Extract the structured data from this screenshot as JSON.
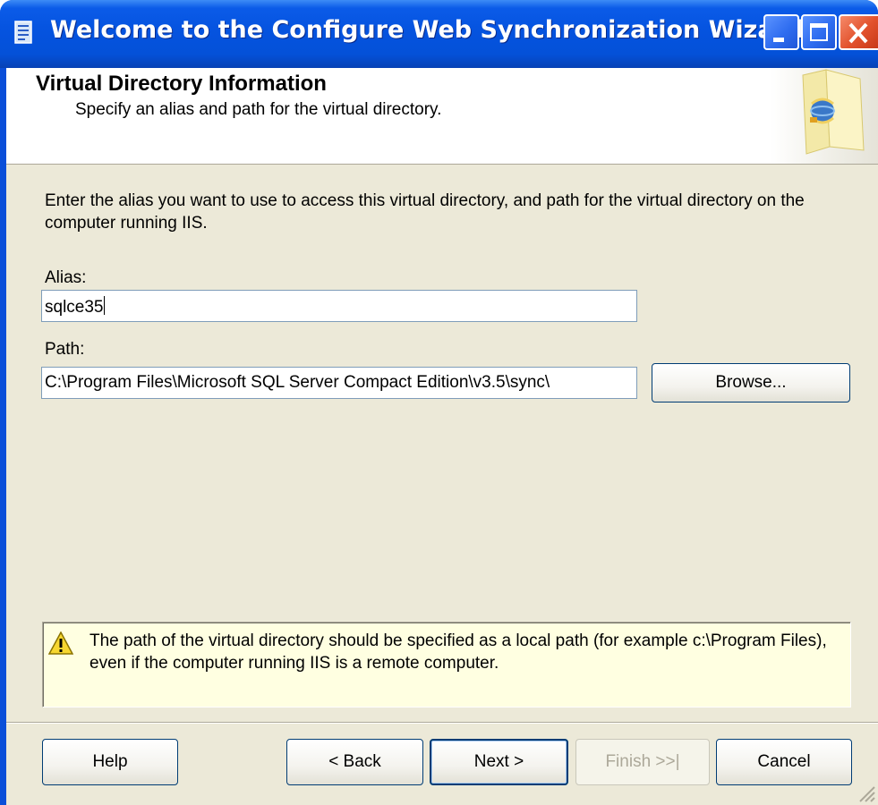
{
  "window": {
    "title": "Welcome to the Configure Web Synchronization Wizard",
    "icon": "wizard-icon"
  },
  "header": {
    "title": "Virtual Directory Information",
    "subtitle": "Specify an alias and path for the virtual directory.",
    "art_icon": "globe-gear-icon"
  },
  "body": {
    "description": "Enter the alias you want to use to access this virtual directory, and path for the virtual directory on the computer running IIS.",
    "alias_label": "Alias:",
    "alias_value": "sqlce35",
    "path_label": "Path:",
    "path_value": "C:\\Program Files\\Microsoft SQL Server Compact Edition\\v3.5\\sync\\",
    "browse_label": "Browse..."
  },
  "warning": {
    "icon": "warning-icon",
    "text": "The path of the virtual directory should be specified as a local path (for example c:\\Program Files), even if the computer running IIS is a remote computer."
  },
  "footer": {
    "help_label": "Help",
    "back_label": "< Back",
    "next_label": "Next >",
    "finish_label": "Finish >>|",
    "cancel_label": "Cancel"
  },
  "colors": {
    "titlebar": "#0553df",
    "dialog_bg": "#ece9d8",
    "info_bg": "#ffffe1",
    "close_button": "#e2512c"
  }
}
